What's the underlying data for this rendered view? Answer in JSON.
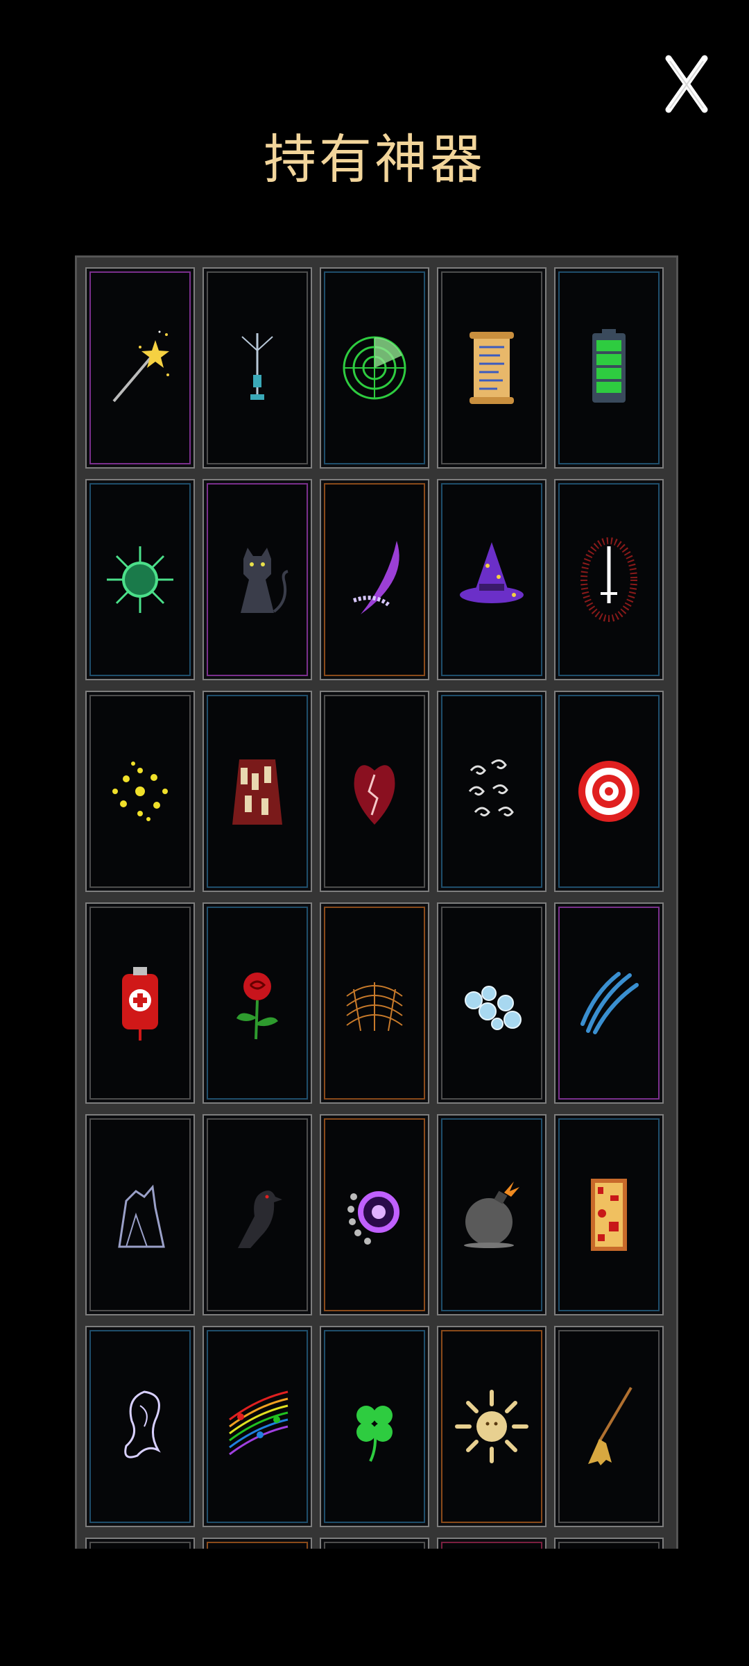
{
  "header": {
    "title": "持有神器"
  },
  "artifacts": [
    {
      "icon": "magic-wand-icon",
      "rim": "#7a2f8c"
    },
    {
      "icon": "antenna-tower-icon",
      "rim": "#4d4d4d"
    },
    {
      "icon": "radar-icon",
      "rim": "#1f4e6b"
    },
    {
      "icon": "scroll-icon",
      "rim": "#4d4d4d"
    },
    {
      "icon": "battery-icon",
      "rim": "#1f4e6b"
    },
    {
      "icon": "virus-icon",
      "rim": "#1f4e6b"
    },
    {
      "icon": "black-cat-icon",
      "rim": "#7a2f8c"
    },
    {
      "icon": "purple-scythe-icon",
      "rim": "#8a4a1a"
    },
    {
      "icon": "witch-hat-icon",
      "rim": "#1f4e6b"
    },
    {
      "icon": "red-sword-icon",
      "rim": "#1f4e6b"
    },
    {
      "icon": "yellow-spores-icon",
      "rim": "#4d4d4d"
    },
    {
      "icon": "talisman-robe-icon",
      "rim": "#1f4e6b"
    },
    {
      "icon": "blood-heart-icon",
      "rim": "#4d4d4d"
    },
    {
      "icon": "wind-swirl-icon",
      "rim": "#1f4e6b"
    },
    {
      "icon": "target-icon",
      "rim": "#1f4e6b"
    },
    {
      "icon": "blood-bag-icon",
      "rim": "#4d4d4d"
    },
    {
      "icon": "red-rose-icon",
      "rim": "#1f4e6b"
    },
    {
      "icon": "orange-web-icon",
      "rim": "#8a4a1a"
    },
    {
      "icon": "bubbles-icon",
      "rim": "#4d4d4d"
    },
    {
      "icon": "feather-quill-icon",
      "rim": "#7a2f8c"
    },
    {
      "icon": "ghost-wolf-icon",
      "rim": "#4d4d4d"
    },
    {
      "icon": "crow-icon",
      "rim": "#4d4d4d"
    },
    {
      "icon": "void-portal-icon",
      "rim": "#8a4a1a"
    },
    {
      "icon": "bomb-icon",
      "rim": "#1f4e6b"
    },
    {
      "icon": "circuit-tablet-icon",
      "rim": "#1f4e6b"
    },
    {
      "icon": "ghost-spirit-icon",
      "rim": "#1f4e6b"
    },
    {
      "icon": "music-notes-icon",
      "rim": "#1f4e6b"
    },
    {
      "icon": "four-leaf-clover-icon",
      "rim": "#1f4e6b"
    },
    {
      "icon": "sun-icon",
      "rim": "#8a4a1a"
    },
    {
      "icon": "broom-icon",
      "rim": "#4d4d4d"
    },
    {
      "icon": "artifact-icon",
      "rim": "#4d4d4d"
    },
    {
      "icon": "artifact-icon",
      "rim": "#8a4a1a"
    },
    {
      "icon": "artifact-icon",
      "rim": "#4d4d4d"
    },
    {
      "icon": "artifact-icon",
      "rim": "#7a2040"
    },
    {
      "icon": "artifact-icon",
      "rim": "#4d4d4d"
    }
  ]
}
